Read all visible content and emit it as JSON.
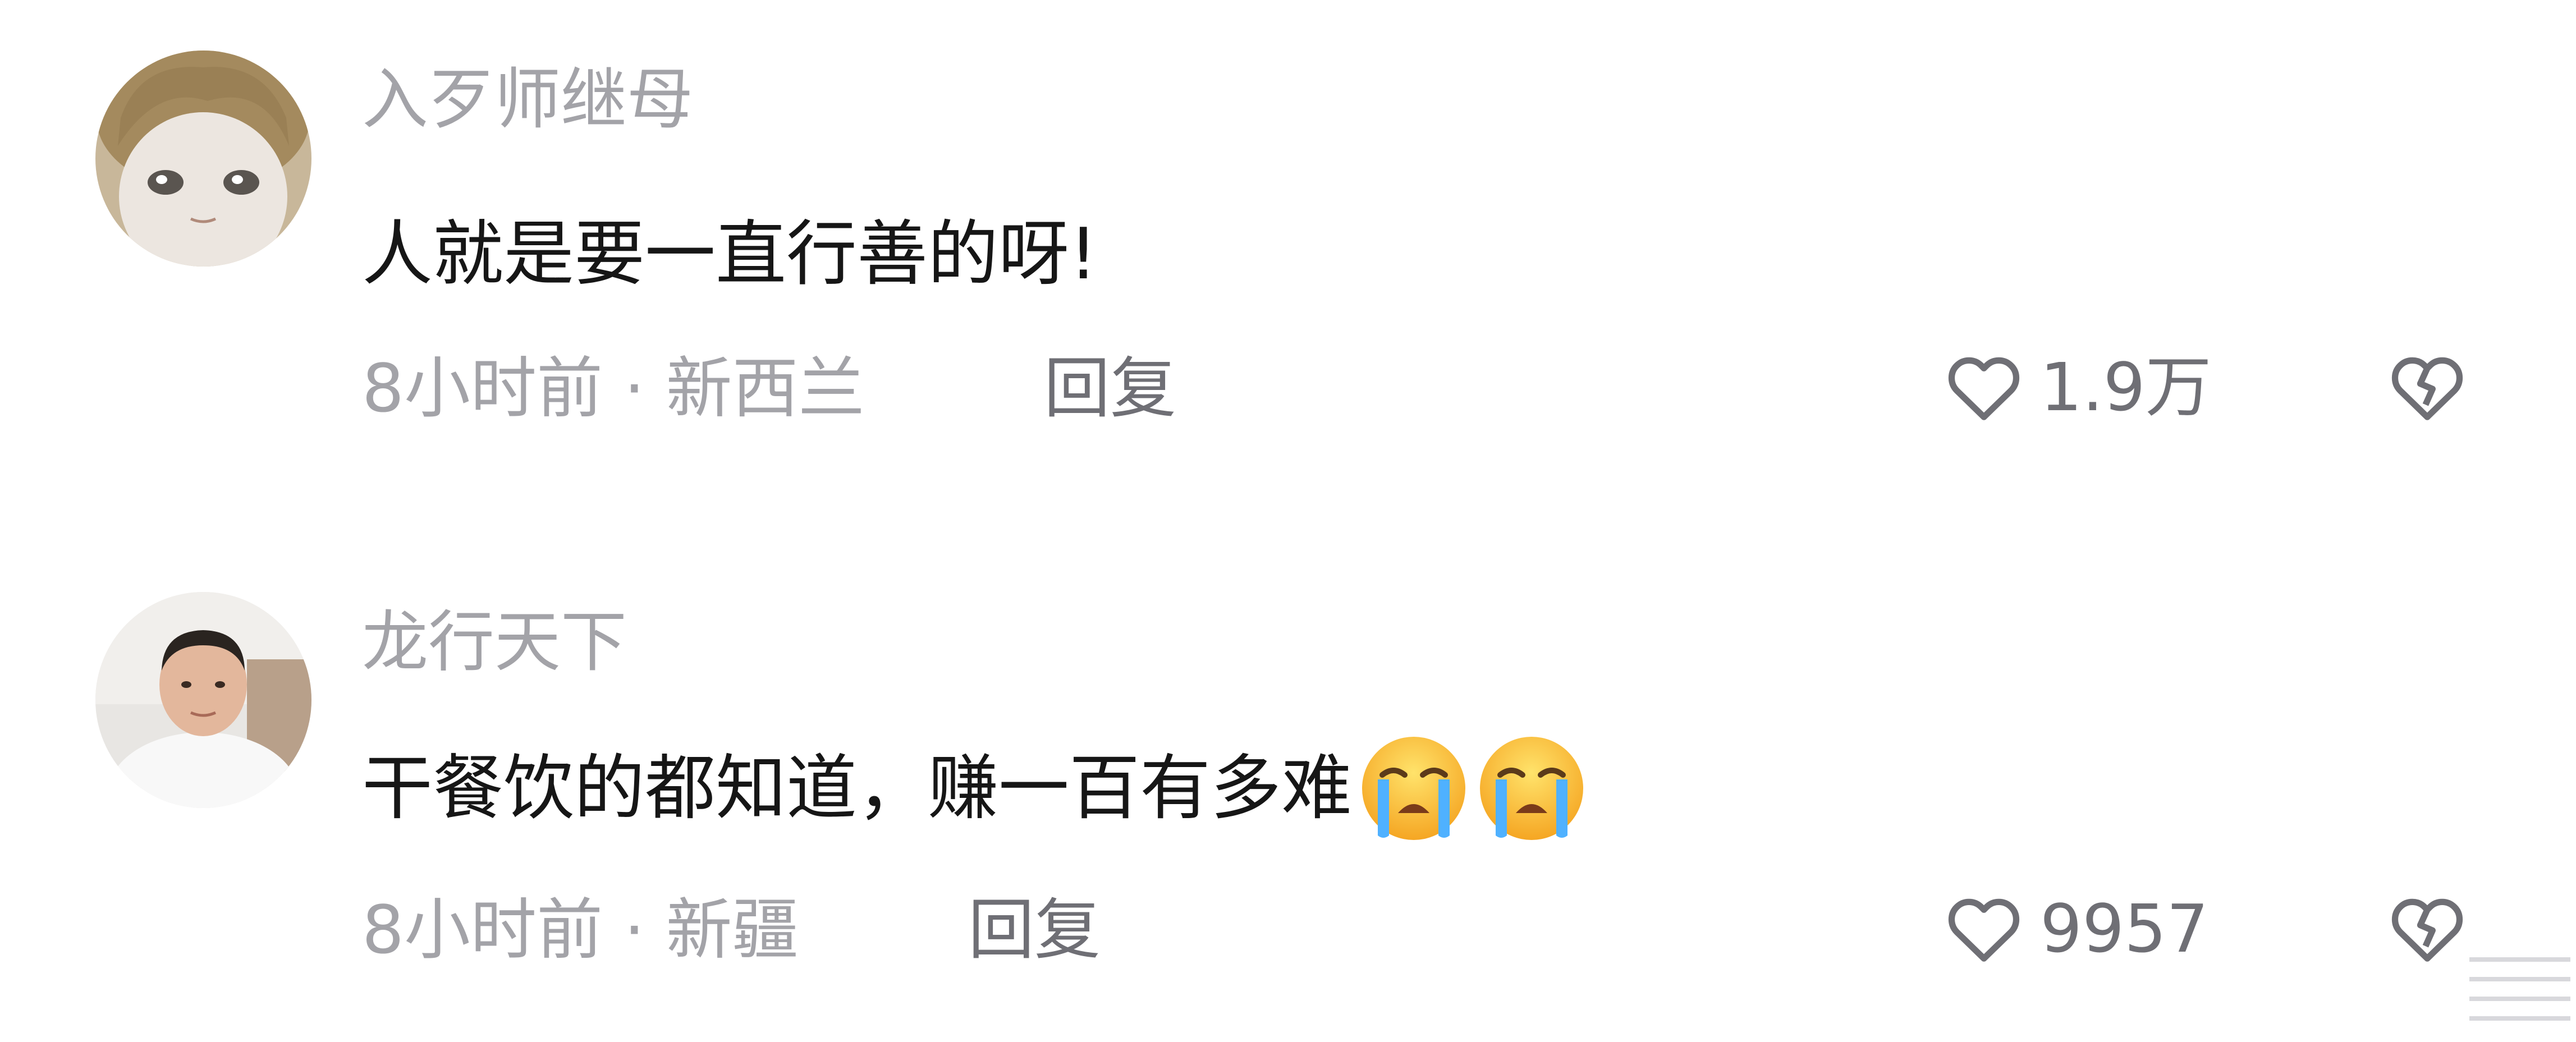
{
  "comments": [
    {
      "username": "入歹师继母",
      "text": "人就是要一直行善的呀!",
      "time": "8小时前",
      "location": "新西兰",
      "meta_separator": "·",
      "reply_label": "回复",
      "like_count": "1.9万",
      "emojis": []
    },
    {
      "username": "龙行天下",
      "text": "干餐饮的都知道，赚一百有多难",
      "time": "8小时前",
      "location": "新疆",
      "meta_separator": "·",
      "reply_label": "回复",
      "like_count": "9957",
      "emojis": [
        "loudly-crying-face",
        "loudly-crying-face"
      ]
    }
  ],
  "colors": {
    "username": "#a3a3a8",
    "text": "#161616",
    "meta": "#a3a3a8",
    "reply": "#6f6f75",
    "icon": "#6f6f75"
  },
  "icons": {
    "like": "heart-outline-icon",
    "dislike": "broken-heart-outline-icon"
  }
}
